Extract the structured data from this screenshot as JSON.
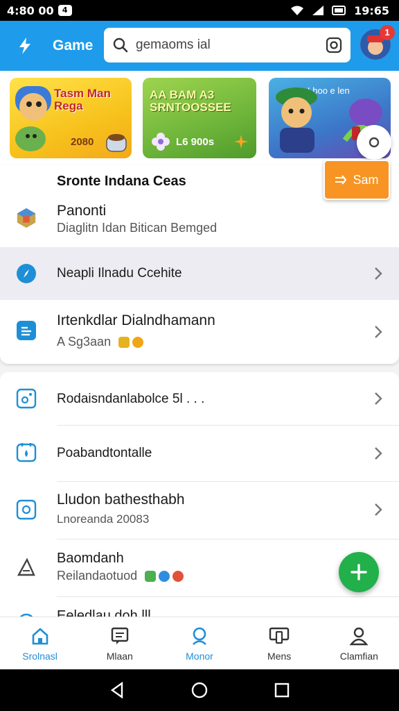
{
  "status_bar": {
    "left_text": "4:80 00",
    "badge": "4",
    "time": "19:65"
  },
  "app_bar": {
    "title": "Game",
    "search_placeholder": "gemaoms ial",
    "avatar_badge": "1"
  },
  "banners": [
    {
      "title": "Tasm Man Rega",
      "subtitle": "2080",
      "color": "#f7c21c"
    },
    {
      "title": "AA BAM A3 SRNTOOSSEE",
      "subtitle": "L6 900s",
      "color": "#6eb53a"
    },
    {
      "title": "Lboo e len",
      "subtitle": "",
      "color": "#3c76c8"
    }
  ],
  "orange_button": {
    "label": "Sam"
  },
  "card1": {
    "title": "Sronte Indana Ceas",
    "items": [
      {
        "title": "Panonti",
        "subtitle": "Diaglitn Idan Bitican Bemged",
        "icon": "game-cube-icon"
      },
      {
        "title": "Neapli Ilnadu Ccehite",
        "subtitle": "",
        "icon": "compass-icon"
      },
      {
        "title": "Irtenkdlar Dialndhamann",
        "subtitle": "A Sg3aan",
        "icon": "receipt-icon"
      }
    ]
  },
  "card2": {
    "items": [
      {
        "title": "Rodaisndanlabolce 5l . . .",
        "subtitle": "",
        "icon": "camera-frame-icon"
      },
      {
        "title": "Poabandtontalle",
        "subtitle": "",
        "icon": "lock-frame-icon"
      },
      {
        "title": "Lludon bathesthabh",
        "subtitle": "Lnoreanda 20083",
        "icon": "badge-frame-icon"
      },
      {
        "title": "Baomdanh",
        "subtitle": "Reilandaotuod",
        "icon": "ruler-triangle-icon"
      },
      {
        "title": "Eeledlau doh lll",
        "subtitle": "",
        "icon": "more-icon"
      }
    ]
  },
  "bottom_nav": [
    {
      "label": "Srolnasl",
      "icon": "home-icon",
      "active": true
    },
    {
      "label": "Mlaan",
      "icon": "chat-icon",
      "active": false
    },
    {
      "label": "Monor",
      "icon": "search-icon",
      "active": true
    },
    {
      "label": "Mens",
      "icon": "devices-icon",
      "active": false
    },
    {
      "label": "Clamfian",
      "icon": "profile-icon",
      "active": false
    }
  ],
  "colors": {
    "accent": "#1e9bea",
    "fab": "#22b04b",
    "orange": "#f79423"
  }
}
